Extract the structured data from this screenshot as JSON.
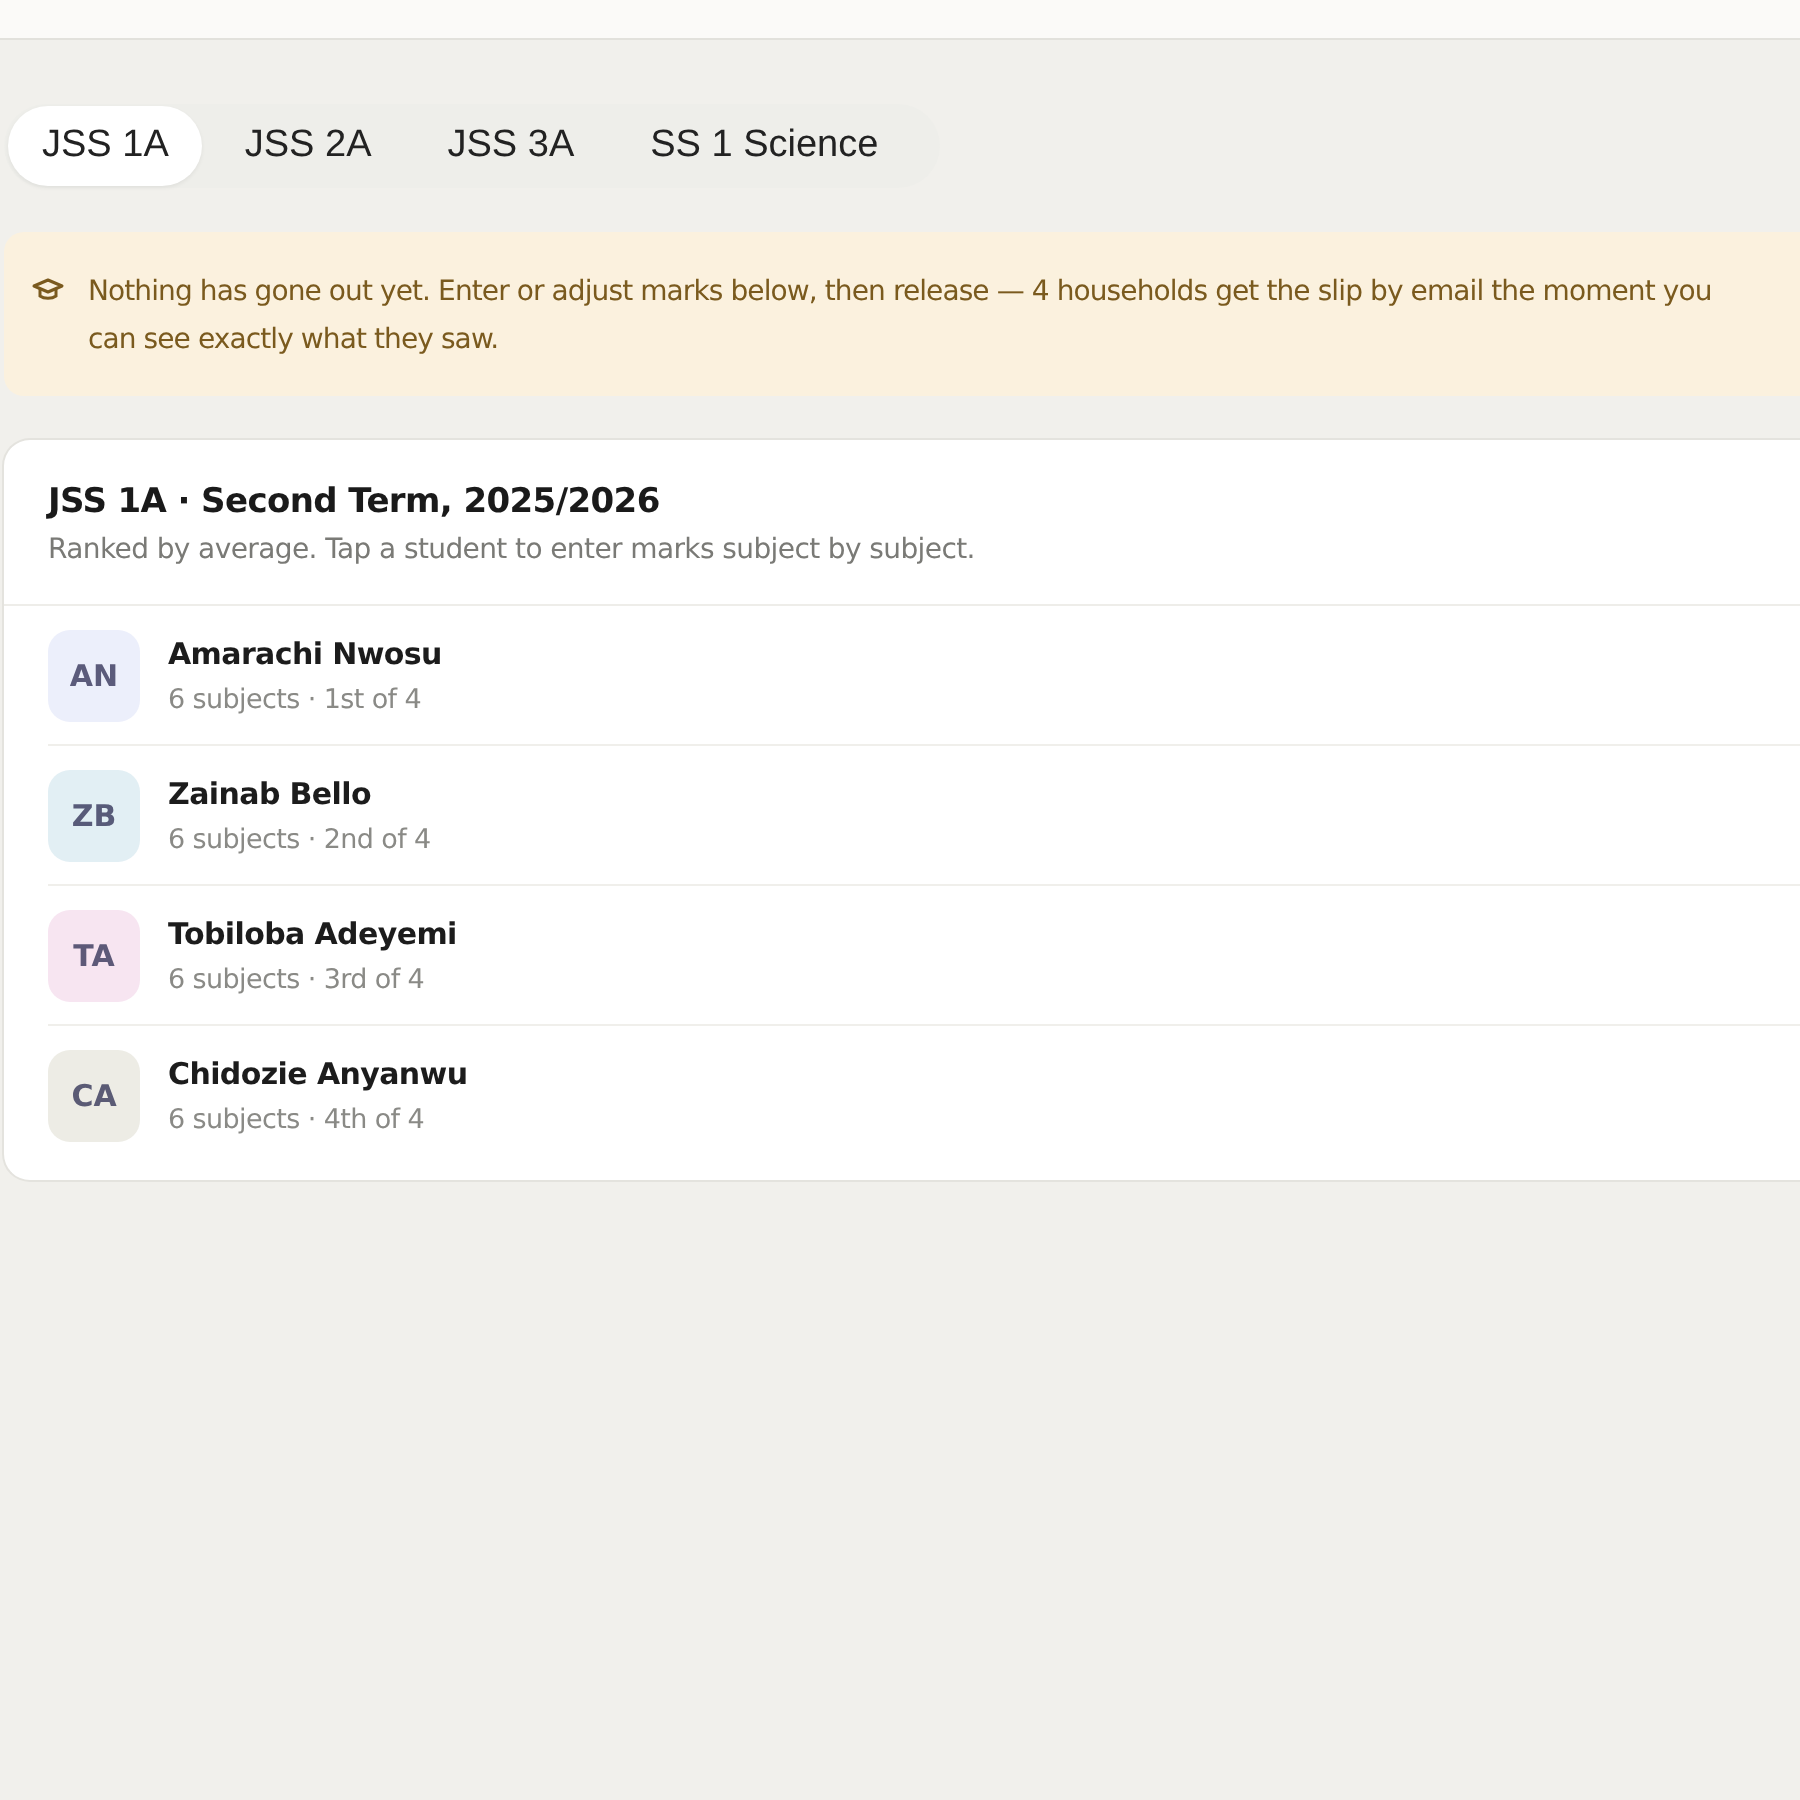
{
  "tabs": [
    {
      "label": "JSS 1A",
      "selected": true
    },
    {
      "label": "JSS 2A",
      "selected": false
    },
    {
      "label": "JSS 3A",
      "selected": false
    },
    {
      "label": "SS 1 Science",
      "selected": false
    }
  ],
  "notice": {
    "lines": [
      "Nothing has gone out yet. Enter or adjust marks below, then release — 4 households get the slip by email the moment you",
      "can see exactly what they saw."
    ]
  },
  "class_card": {
    "title": "JSS 1A · Second Term, 2025/2026",
    "subtitle": "Ranked by average. Tap a student to enter marks subject by subject.",
    "students": [
      {
        "initials": "AN",
        "name": "Amarachi Nwosu",
        "detail": "6 subjects · 1st of 4",
        "color": "#eceffb"
      },
      {
        "initials": "ZB",
        "name": "Zainab Bello",
        "detail": "6 subjects · 2nd of 4",
        "color": "#e2eff4"
      },
      {
        "initials": "TA",
        "name": "Tobiloba Adeyemi",
        "detail": "6 subjects · 3rd of 4",
        "color": "#f7e5f1"
      },
      {
        "initials": "CA",
        "name": "Chidozie Anyanwu",
        "detail": "6 subjects · 4th of 4",
        "color": "#edece5"
      }
    ]
  }
}
